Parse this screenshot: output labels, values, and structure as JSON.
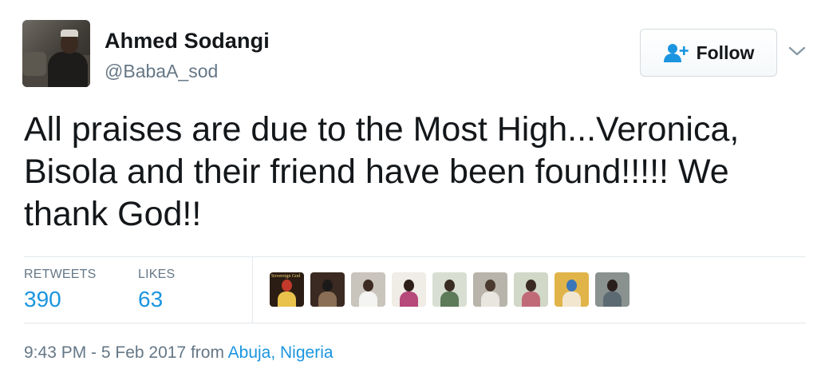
{
  "user": {
    "name": "Ahmed Sodangi",
    "handle": "@BabaA_sod"
  },
  "follow_button": {
    "label": "Follow",
    "icon": "add-user-icon"
  },
  "menu_icon": "chevron-down-icon",
  "tweet": {
    "text": "All praises are due to the Most High...Veronica, Bisola and their friend have been found!!!!! We thank God!!"
  },
  "stats": {
    "retweets_label": "RETWEETS",
    "retweets_value": "390",
    "likes_label": "LIKES",
    "likes_value": "63"
  },
  "likers": [
    {
      "avatar": "Sovereign God",
      "colors": [
        "#2b1d14",
        "#c23a2a",
        "#e8c24a"
      ]
    },
    {
      "avatar": "person-dark-photo",
      "colors": [
        "#3a2a22",
        "#1c1a19",
        "#8a6e55"
      ]
    },
    {
      "avatar": "person-white-shirt",
      "colors": [
        "#c9c4bc",
        "#3d2b21",
        "#f4f4f2"
      ]
    },
    {
      "avatar": "person-portrait",
      "colors": [
        "#f0ece6",
        "#2e1f19",
        "#b6487a"
      ]
    },
    {
      "avatar": "person-outdoor",
      "colors": [
        "#d8dfd2",
        "#3a2c22",
        "#5d7a59"
      ]
    },
    {
      "avatar": "group-photo",
      "colors": [
        "#b9b4ab",
        "#4a3a30",
        "#e9e6e0"
      ]
    },
    {
      "avatar": "person-standing",
      "colors": [
        "#d2d8c8",
        "#3a2a22",
        "#c06a78"
      ]
    },
    {
      "avatar": "colorful-photo",
      "colors": [
        "#e1b44a",
        "#3a76b8",
        "#f2e6cf"
      ]
    },
    {
      "avatar": "person-closeup",
      "colors": [
        "#8a9290",
        "#2a1f1a",
        "#5c6a73"
      ]
    }
  ],
  "meta": {
    "timestamp": "9:43 PM - 5 Feb 2017 from ",
    "location": "Abuja, Nigeria"
  },
  "colors": {
    "link": "#1b95e0",
    "secondary_text": "#657786",
    "primary_text": "#14171a",
    "border": "#e1e8ed"
  }
}
